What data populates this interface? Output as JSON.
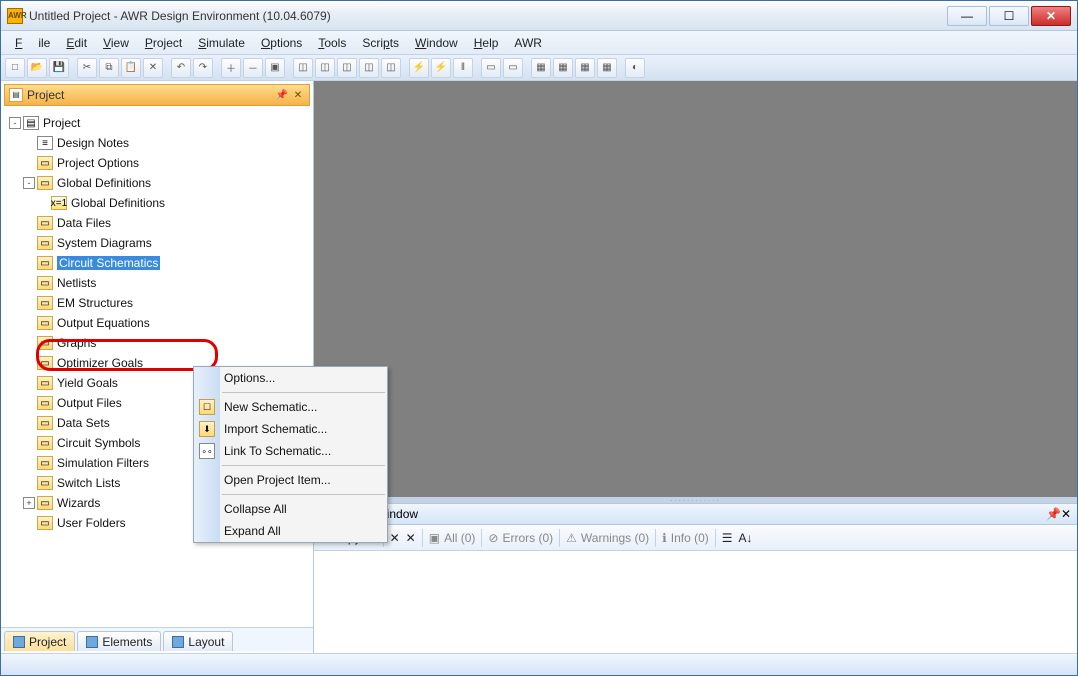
{
  "window": {
    "title": "Untitled Project - AWR Design Environment (10.04.6079)",
    "app_icon_text": "AWR"
  },
  "menu": {
    "file": "File",
    "edit": "Edit",
    "view": "View",
    "project": "Project",
    "simulate": "Simulate",
    "options": "Options",
    "tools": "Tools",
    "scripts": "Scripts",
    "window": "Window",
    "help": "Help",
    "awr": "AWR"
  },
  "project_panel": {
    "title": "Project",
    "root": "Project",
    "nodes": {
      "design_notes": "Design Notes",
      "project_options": "Project Options",
      "global_defs": "Global Definitions",
      "global_defs_child": "Global Definitions",
      "data_files": "Data Files",
      "system_diagrams": "System Diagrams",
      "circuit_schematics": "Circuit Schematics",
      "netlists": "Netlists",
      "em_structures": "EM Structures",
      "output_equations": "Output Equations",
      "graphs": "Graphs",
      "optimizer_goals": "Optimizer Goals",
      "yield_goals": "Yield Goals",
      "output_files": "Output Files",
      "data_sets": "Data Sets",
      "circuit_symbols": "Circuit Symbols",
      "simulation_filters": "Simulation Filters",
      "switch_lists": "Switch Lists",
      "wizards": "Wizards",
      "user_folders": "User Folders"
    }
  },
  "context_menu": {
    "options": "Options...",
    "new_schematic": "New Schematic...",
    "import_schematic": "Import Schematic...",
    "link_to_schematic": "Link To Schematic...",
    "open_project_item": "Open Project Item...",
    "collapse_all": "Collapse All",
    "expand_all": "Expand All"
  },
  "bottom_tabs": {
    "project": "Project",
    "elements": "Elements",
    "layout": "Layout"
  },
  "status_window": {
    "title": "Status Window",
    "copy_all": "Copy All",
    "all": "All (0)",
    "errors": "Errors (0)",
    "warnings": "Warnings (0)",
    "info": "Info (0)"
  }
}
